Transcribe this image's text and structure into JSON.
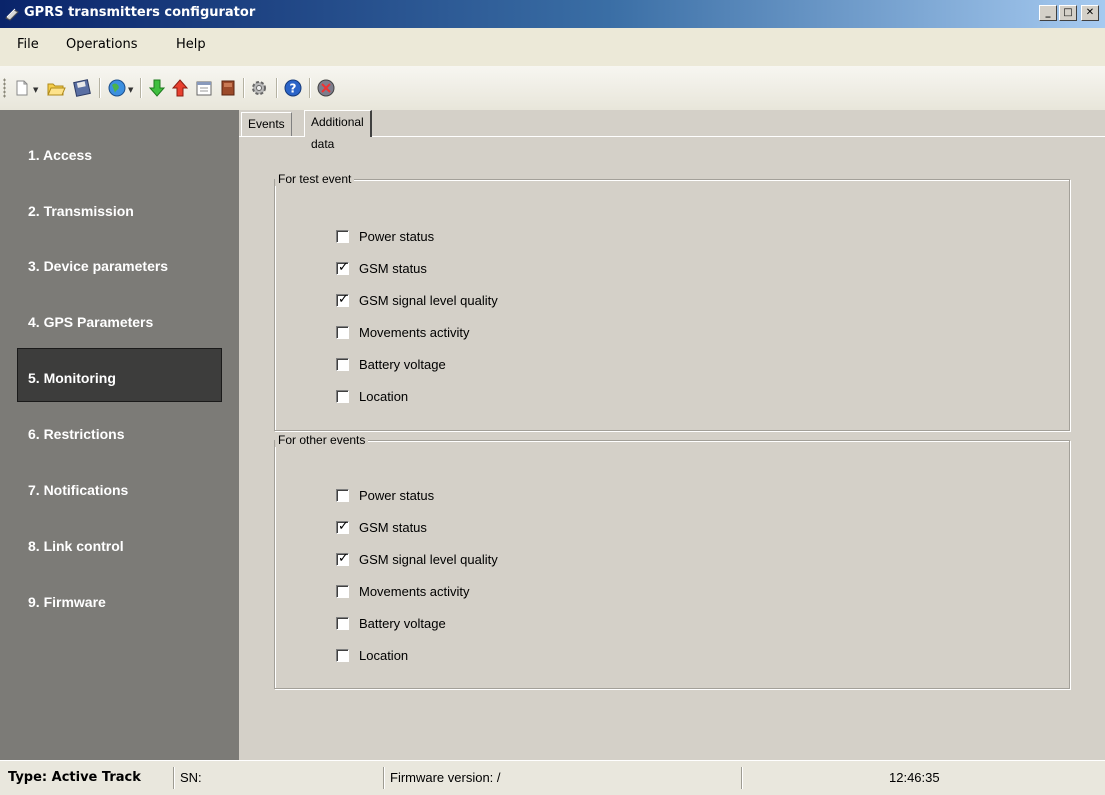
{
  "window": {
    "title": "GPRS transmitters configurator",
    "minimize_label": "_",
    "maximize_label": "□",
    "close_label": "✕"
  },
  "menu": {
    "items": [
      {
        "label": "File"
      },
      {
        "label": "Operations"
      },
      {
        "label": "Help"
      }
    ]
  },
  "toolbar": {
    "buttons": [
      {
        "icon": "new-icon"
      },
      {
        "icon": "open-folder-icon"
      },
      {
        "icon": "save-icon"
      },
      {
        "icon": "globe-icon"
      },
      {
        "icon": "download-arrow-icon"
      },
      {
        "icon": "upload-arrow-icon"
      },
      {
        "icon": "calendar-icon"
      },
      {
        "icon": "book-icon"
      },
      {
        "icon": "settings-gear-icon"
      },
      {
        "icon": "help-icon"
      },
      {
        "icon": "exit-icon"
      }
    ]
  },
  "sidebar": {
    "active": "5. Monitoring",
    "items": [
      {
        "label": "1. Access"
      },
      {
        "label": "2. Transmission"
      },
      {
        "label": "3. Device parameters"
      },
      {
        "label": "4. GPS Parameters"
      },
      {
        "label": "5. Monitoring"
      },
      {
        "label": "6. Restrictions"
      },
      {
        "label": "7. Notifications"
      },
      {
        "label": "8. Link control"
      },
      {
        "label": "9. Firmware"
      }
    ]
  },
  "tabs": {
    "items": [
      {
        "label": "Events"
      },
      {
        "label": "Additional data"
      }
    ],
    "active": "Additional data"
  },
  "groups": [
    {
      "title": "For test event",
      "options": [
        {
          "label": "Power status",
          "checked": false
        },
        {
          "label": "GSM status",
          "checked": true
        },
        {
          "label": "GSM signal level quality",
          "checked": true
        },
        {
          "label": "Movements activity",
          "checked": false
        },
        {
          "label": "Battery voltage",
          "checked": false
        },
        {
          "label": "Location",
          "checked": false
        }
      ]
    },
    {
      "title": "For other events",
      "options": [
        {
          "label": "Power status",
          "checked": false
        },
        {
          "label": "GSM status",
          "checked": true
        },
        {
          "label": "GSM signal level quality",
          "checked": true
        },
        {
          "label": "Movements activity",
          "checked": false
        },
        {
          "label": "Battery voltage",
          "checked": false
        },
        {
          "label": "Location",
          "checked": false
        }
      ]
    }
  ],
  "statusbar": {
    "type": "Type: Active Track",
    "sn": "SN:",
    "firmware": "Firmware version: /",
    "time": "12:46:35"
  }
}
